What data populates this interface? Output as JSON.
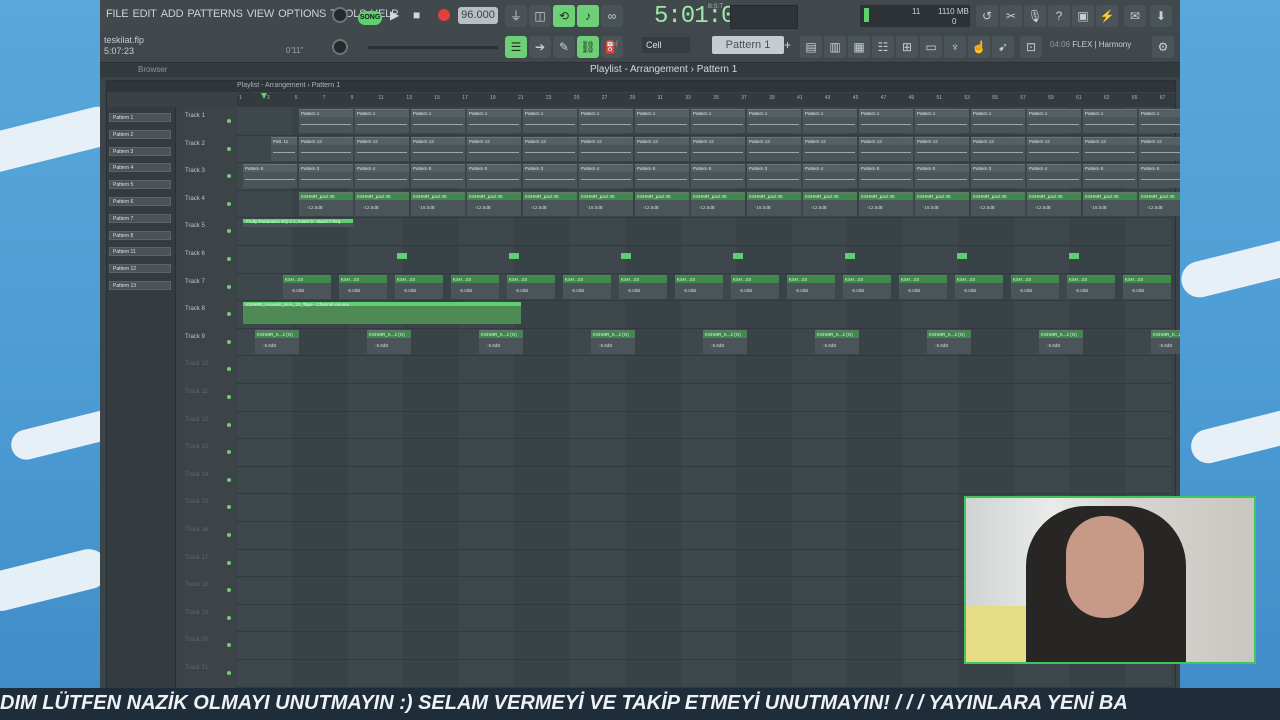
{
  "menu": [
    "FILE",
    "EDIT",
    "ADD",
    "PATTERNS",
    "VIEW",
    "OPTIONS",
    "TOOLS",
    "HELP"
  ],
  "transport": {
    "mode_label": "SONG",
    "tempo": "96.000",
    "time": "5:01:00",
    "time_unit": "B:S:T"
  },
  "monitor": {
    "voices": "11",
    "memory": "1110 MB",
    "memory_sub": "0"
  },
  "project": {
    "filename": "teskilat.flp",
    "time": "5:07:23",
    "elapsed": "0'11''"
  },
  "hint": {
    "time": "04:06",
    "text": "FLEX | Harmony"
  },
  "browser": {
    "label": "Browser"
  },
  "snap": {
    "label": "Cell"
  },
  "pattern_selector": {
    "value": "Pattern 1"
  },
  "playlist": {
    "title": "Playlist - Arrangement",
    "pattern": "Pattern 1",
    "tab_title": "Playlist - Arrangement › Pattern 1"
  },
  "pattern_picker": [
    "Pattern 1",
    "Pattern 2",
    "Pattern 3",
    "Pattern 4",
    "Pattern 5",
    "Pattern 6",
    "Pattern 7",
    "Pattern 8",
    "Pattern 11",
    "Pattern 12",
    "Pattern 13"
  ],
  "tracks": [
    "Track 1",
    "Track 2",
    "Track 3",
    "Track 4",
    "Track 5",
    "Track 6",
    "Track 7",
    "Track 8",
    "Track 9",
    "Track 10",
    "Track 11",
    "Track 12",
    "Track 13",
    "Track 14",
    "Track 15",
    "Track 16",
    "Track 17",
    "Track 18",
    "Track 19",
    "Track 20",
    "Track 21"
  ],
  "ruler_numbers": [
    "1",
    "3",
    "5",
    "7",
    "9",
    "11",
    "13",
    "15",
    "17",
    "19",
    "21",
    "23",
    "25",
    "27",
    "29",
    "31",
    "33",
    "35",
    "37",
    "39",
    "41",
    "43",
    "45",
    "47",
    "49",
    "51",
    "53",
    "55",
    "57",
    "59",
    "61",
    "63",
    "65",
    "67"
  ],
  "clip_labels": {
    "t1": "Pattern 1",
    "t2a": "Patt. 11",
    "t2": "Pattern 12",
    "t2b": "Pattern 13",
    "t3a": "Pattern 6",
    "t3b": "Pattern 3",
    "t3c": "Pattern 4",
    "t3d": "Pattern 8",
    "t3e": "Pattern 5",
    "t4": "KSHMR_pact 05",
    "t4_db_a": "-12.5dB",
    "t4_db_b": "-15.0dB",
    "t5": "Fruity Parametric EQ 2 1, Insert 6 - Band 7 freq",
    "t7": "KSH...03",
    "t7_db": "-8.0dB",
    "t8": "KSHMR_Acoustic_Kick_12_Tape - Channel volume",
    "t9": "KSHMR_K...2 (G)",
    "t9_db": "-8.9dB"
  },
  "ticker_text": "DIM LÜTFEN NAZİK OLMAYI UNUTMAYIN   :)    SELAM VERMEYİ VE TAKİP ETMEYİ UNUTMAYIN!   / / /  YAYINLARA YENİ BA",
  "colors": {
    "accent": "#5fd06f",
    "panel": "#3b4448",
    "webcam_border": "#42c35c"
  }
}
